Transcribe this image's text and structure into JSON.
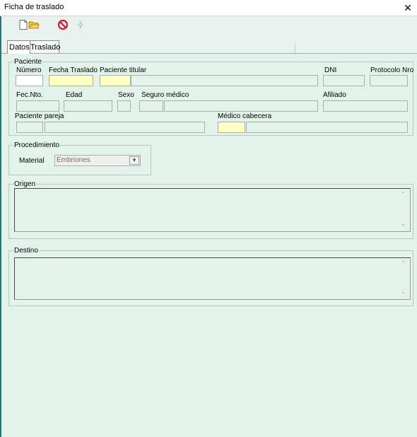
{
  "window": {
    "title": "Ficha de traslado",
    "close_glyph": "✕"
  },
  "toolbar": {
    "icons": [
      "new-document-icon",
      "open-folder-icon",
      "cancel-icon",
      "lightning-icon"
    ]
  },
  "tabs": [
    {
      "label": "Datos",
      "active": true
    },
    {
      "label": "Traslado",
      "active": false
    }
  ],
  "paciente": {
    "legend": "Paciente",
    "numero_label": "Número",
    "fecha_traslado_label": "Fecha Traslado",
    "paciente_titular_label": "Paciente titular",
    "dni_label": "DNI",
    "protocolo_label": "Protocolo Nro",
    "fec_nto_label": "Fec.Nto.",
    "edad_label": "Edad",
    "sexo_label": "Sexo",
    "seguro_label": "Seguro médico",
    "afiliado_label": "Afiliado",
    "pareja_label": "Paciente pareja",
    "medico_label": "Médico cabecera"
  },
  "procedimiento": {
    "legend": "Procedimiento",
    "material_label": "Material",
    "material_value": "Embriones"
  },
  "origen": {
    "legend": "Origen",
    "value": ""
  },
  "destino": {
    "legend": "Destino",
    "value": ""
  },
  "colors": {
    "background": "#e2f3ea",
    "required_field": "#ffffc4",
    "editable_field": "#ffffff",
    "cancel_red": "#d9142a",
    "folder_yellow": "#f4c430"
  }
}
